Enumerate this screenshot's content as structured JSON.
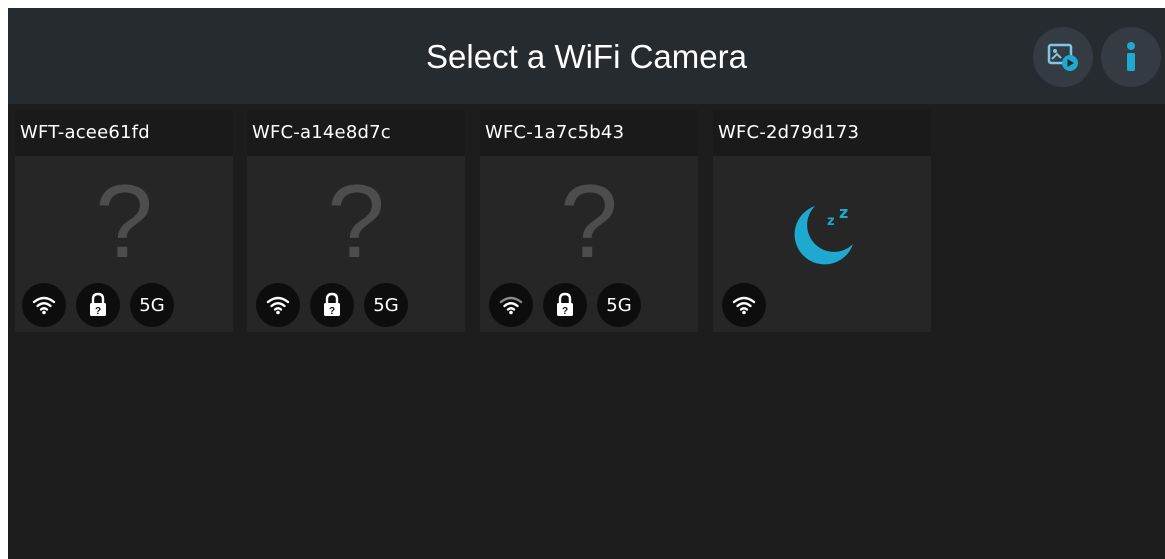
{
  "header": {
    "title": "Select a WiFi Camera",
    "media_icon": "gallery-play-icon",
    "info_icon": "info-icon"
  },
  "colors": {
    "accent": "#1eaad0",
    "header_bg": "#262b30",
    "app_bg": "#1d1d1d",
    "card_bg": "#262626"
  },
  "cameras": [
    {
      "name": "WFT-acee61fd",
      "status": "unknown",
      "badge_5g": "5G",
      "icons": [
        "wifi-icon",
        "lock-icon"
      ]
    },
    {
      "name": "WFC-a14e8d7c",
      "status": "unknown",
      "badge_5g": "5G",
      "icons": [
        "wifi-icon",
        "lock-icon"
      ]
    },
    {
      "name": "WFC-1a7c5b43",
      "status": "unknown",
      "badge_5g": "5G",
      "icons": [
        "wifi-icon",
        "lock-icon"
      ]
    },
    {
      "name": "WFC-2d79d173",
      "status": "sleeping",
      "icons": [
        "wifi-icon",
        "sleep-moon-icon"
      ]
    }
  ],
  "placeholder_glyph": "?"
}
